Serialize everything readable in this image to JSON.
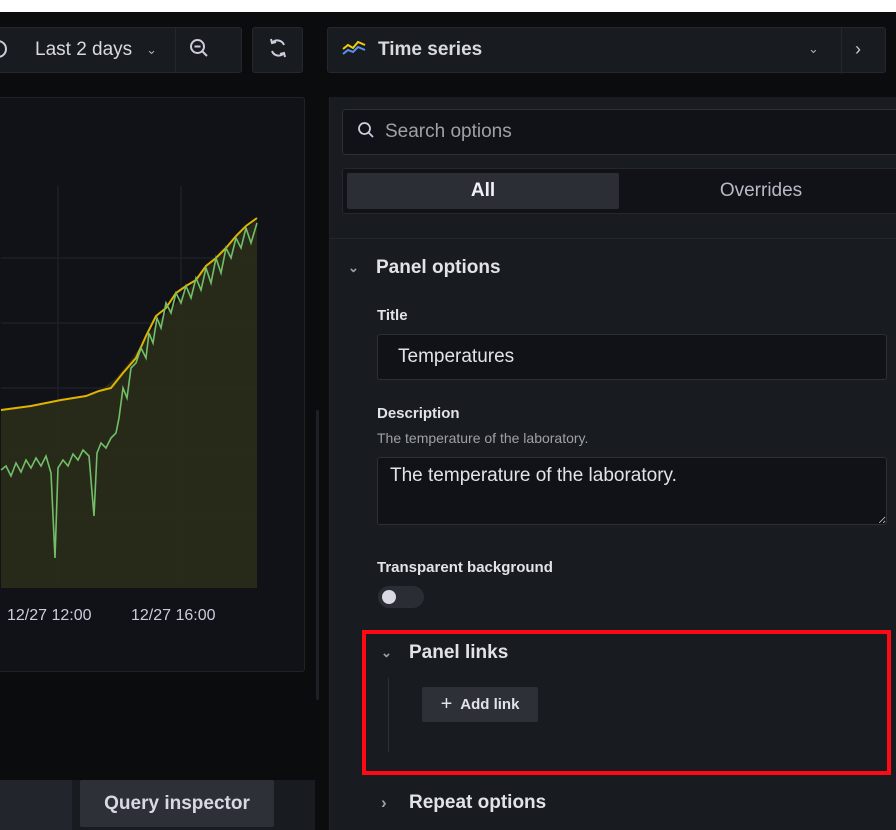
{
  "toolbar": {
    "time_range": "Last 2 days",
    "visualization": "Time series"
  },
  "chart": {
    "x_ticks": [
      "12/27 12:00",
      "12/27 16:00"
    ],
    "colors": {
      "max_line": "#e0b400",
      "value_line": "#73bf69",
      "fill": "#2a2d1a"
    }
  },
  "bottom": {
    "query_inspector": "Query inspector"
  },
  "options": {
    "search_placeholder": "Search options",
    "tabs": [
      "All",
      "Overrides"
    ],
    "panel_options": {
      "header": "Panel options",
      "title_label": "Title",
      "title_value": "Temperatures",
      "description_label": "Description",
      "description_help": "The temperature of the laboratory.",
      "description_value": "The temperature of the laboratory.",
      "transparent_label": "Transparent background"
    },
    "panel_links": {
      "header": "Panel links",
      "add_link": "Add link"
    },
    "repeat_options": {
      "header": "Repeat options"
    }
  }
}
